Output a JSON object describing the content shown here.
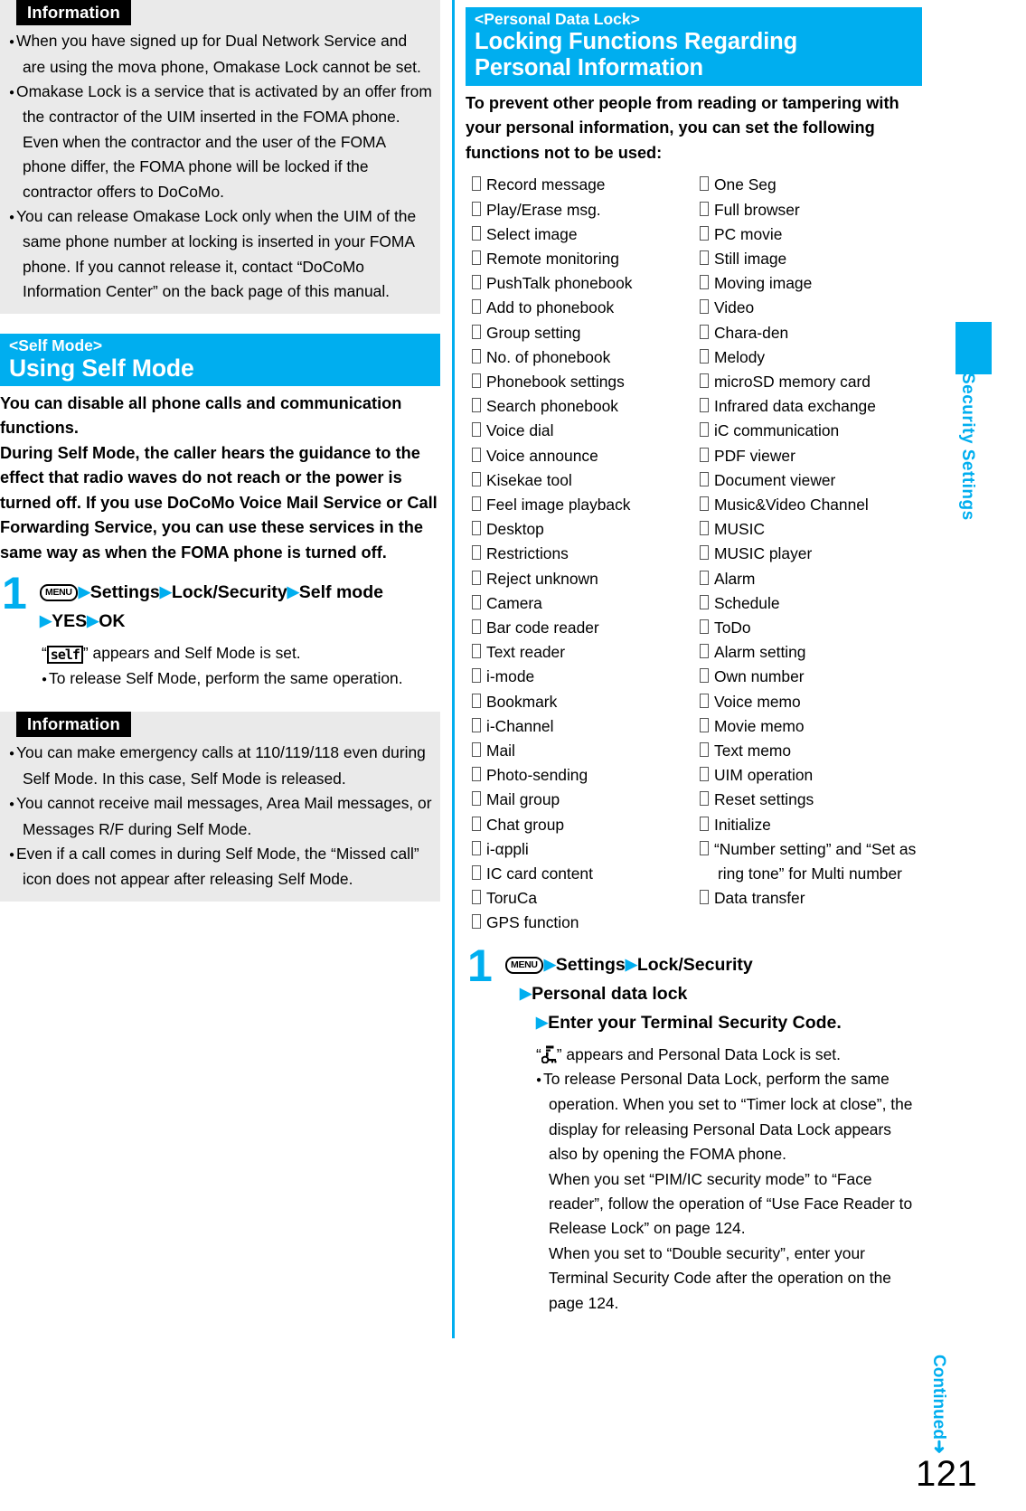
{
  "page": {
    "number": "121",
    "side_tab_label": "Security Settings",
    "continued_label": "Continued",
    "continued_arrow": "➜"
  },
  "left_column": {
    "info_box_1": {
      "label": "Information",
      "items": [
        "When you have signed up for Dual Network Service and are using the mova phone, Omakase Lock cannot be set.",
        "Omakase Lock is a service that is activated by an offer from the contractor of the UIM inserted in the FOMA phone. Even when the contractor and the user of the FOMA phone differ, the FOMA phone will be locked if the contractor offers to DoCoMo.",
        "You can release Omakase Lock only when the UIM of the same phone number at locking is inserted in your FOMA phone. If you cannot release it, contact “DoCoMo Information Center” on the back page of this manual."
      ]
    },
    "section": {
      "kicker": "<Self Mode>",
      "title": "Using Self Mode",
      "lead_1": "You can disable all phone calls and communication functions.",
      "lead_2": "During Self Mode, the caller hears the guidance to the effect that radio waves do not reach or the power is turned off. If you use DoCoMo Voice Mail Service or Call Forwarding Service, you can use these services in the same way as when the FOMA phone is turned off.",
      "step": {
        "number": "1",
        "keycap": "MENU",
        "line1_parts": [
          "Settings",
          "Lock/Security",
          "Self mode"
        ],
        "line2_parts": [
          "YES",
          "OK"
        ],
        "note_icon_label": "self",
        "note_main_prefix": "“",
        "note_main_suffix": "” appears and Self Mode is set.",
        "note_sub": "To release Self Mode, perform the same operation."
      }
    },
    "info_box_2": {
      "label": "Information",
      "items": [
        "You can make emergency calls at 110/119/118 even during Self Mode. In this case, Self Mode is released.",
        "You cannot receive mail messages, Area Mail messages, or Messages R/F during Self Mode.",
        "Even if a call comes in during Self Mode, the “Missed call” icon does not appear after releasing Self Mode."
      ]
    }
  },
  "right_column": {
    "section": {
      "kicker": "<Personal Data Lock>",
      "title_line1": "Locking Functions Regarding",
      "title_line2": "Personal Information",
      "lead": "To prevent other people from reading or tampering with your personal information, you can set the following functions not to be used:"
    },
    "functions_left": [
      "Record message",
      "Play/Erase msg.",
      "Select image",
      "Remote monitoring",
      "PushTalk phonebook",
      "Add to phonebook",
      "Group setting",
      "No. of phonebook",
      "Phonebook settings",
      "Search phonebook",
      "Voice dial",
      "Voice announce",
      "Kisekae tool",
      "Feel image playback",
      "Desktop",
      "Restrictions",
      "Reject unknown",
      "Camera",
      "Bar code reader",
      "Text reader",
      "i-mode",
      "Bookmark",
      "i-Channel",
      "Mail",
      "Photo-sending",
      "Mail group",
      "Chat group",
      "i-αppli",
      "IC card content",
      "ToruCa",
      "GPS function"
    ],
    "functions_right": [
      "One Seg",
      "Full browser",
      "PC movie",
      "Still image",
      "Moving image",
      "Video",
      "Chara-den",
      "Melody",
      "microSD memory card",
      "Infrared data exchange",
      "iC communication",
      "PDF viewer",
      "Document viewer",
      "Music&Video Channel",
      "MUSIC",
      "MUSIC player",
      "Alarm",
      "Schedule",
      "ToDo",
      "Alarm setting",
      "Own number",
      "Voice memo",
      "Movie memo",
      "Text memo",
      "UIM operation",
      "Reset settings",
      "Initialize",
      "“Number setting” and “Set as ring tone” for Multi number",
      "Data transfer"
    ],
    "step": {
      "number": "1",
      "keycap": "MENU",
      "line1_parts": [
        "Settings",
        "Lock/Security"
      ],
      "line2_parts": [
        "Personal data lock"
      ],
      "line3_parts": [
        "Enter your Terminal Security Code."
      ],
      "note_main_prefix": "“",
      "note_main_suffix": "” appears and Personal Data Lock is set.",
      "note_sub": "To release Personal Data Lock, perform the same operation. When you set to “Timer lock at close”, the display for releasing Personal Data Lock appears also by opening the FOMA phone.",
      "note_cont_1": "When you set “PIM/IC security mode” to “Face reader”, follow the operation of “Use Face Reader to Release Lock” on page 124.",
      "note_cont_2": "When you set to “Double security”, enter your Terminal Security Code after the operation on the page 124."
    }
  },
  "colors": {
    "accent": "#00AEEF",
    "info_bg": "#EAEAEA",
    "label_bg": "#000000"
  }
}
